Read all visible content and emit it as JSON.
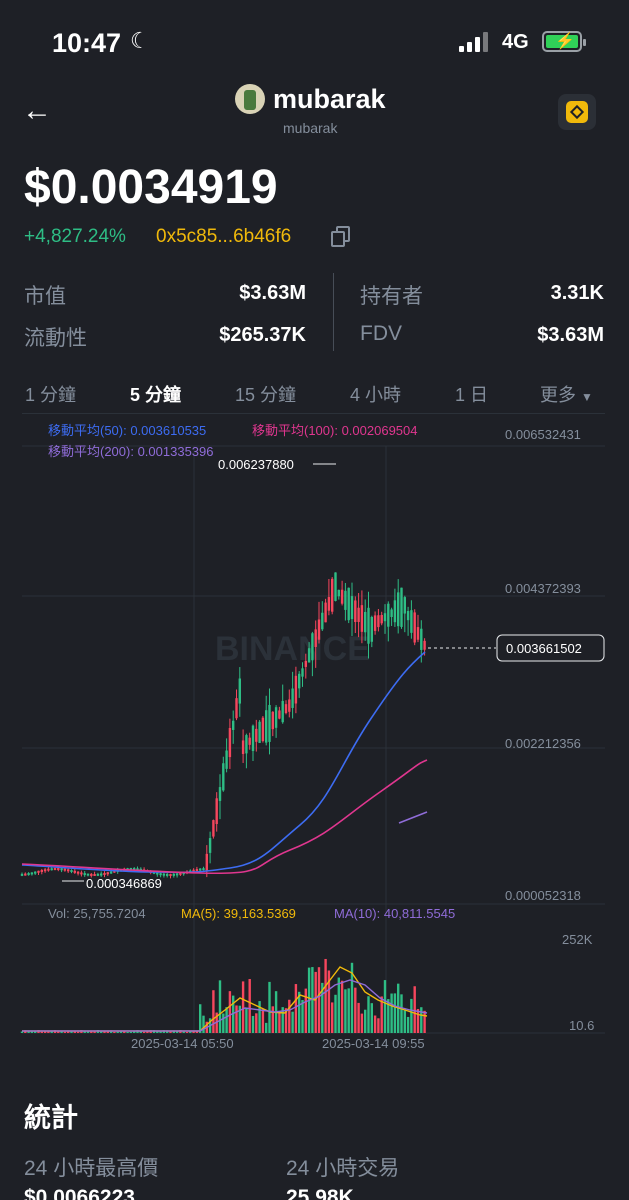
{
  "status_bar": {
    "time": "10:47",
    "network": "4G"
  },
  "header": {
    "title": "mubarak",
    "subtitle": "mubarak"
  },
  "price": "$0.0034919",
  "change": "+4,827.24%",
  "contract": "0x5c85...6b46f6",
  "stats": {
    "market_cap_label": "市值",
    "market_cap_value": "$3.63M",
    "holders_label": "持有者",
    "holders_value": "3.31K",
    "liquidity_label": "流動性",
    "liquidity_value": "$265.37K",
    "fdv_label": "FDV",
    "fdv_value": "$3.63M"
  },
  "tabs": [
    "1 分鐘",
    "5 分鐘",
    "15 分鐘",
    "4 小時",
    "1 日",
    "更多"
  ],
  "active_tab": "5 分鐘",
  "colors": {
    "up": "#2ebd85",
    "down": "#f6465d",
    "ma50": "#3d6cf2",
    "ma100": "#e0368f",
    "ma200": "#8f6cd8",
    "vol_ma5": "#f0b90b",
    "vol_ma10": "#8f6cd8",
    "accent": "#f0b90b"
  },
  "chart": {
    "ma50": "移動平均(50): 0.003610535",
    "ma100": "移動平均(100): 0.002069504",
    "ma200": "移動平均(200): 0.001335396",
    "high_label": "0.006237880",
    "low_label": "0.000346869",
    "last_price_label": "0.003661502",
    "y_ticks": [
      "0.006532431",
      "0.004372393",
      "0.002212356",
      "0.000052318"
    ],
    "vol": "Vol: 25,755.7204",
    "vol_ma5": "MA(5): 39,163.5369",
    "vol_ma10": "MA(10): 40,811.5545",
    "vol_ticks": [
      "252K",
      "10.6"
    ],
    "x_ticks": [
      "2025-03-14 05:50",
      "2025-03-14 09:55"
    ],
    "watermark": "BINANCE"
  },
  "chart_data": {
    "type": "candlestick",
    "ylim": [
      5.2318e-05,
      0.006532431
    ],
    "y_ticks": [
      0.006532431,
      0.004372393,
      0.002212356,
      5.2318e-05
    ],
    "high": 0.00623788,
    "low": 0.000346869,
    "last": 0.003661502,
    "x_ticks": [
      "2025-03-14 05:50",
      "2025-03-14 09:55"
    ],
    "moving_averages": [
      {
        "name": "移動平均(50)",
        "value": 0.003610535
      },
      {
        "name": "移動平均(100)",
        "value": 0.002069504
      },
      {
        "name": "移動平均(200)",
        "value": 0.001335396
      }
    ],
    "volume": {
      "last": 25755.7204,
      "ma5": 39163.5369,
      "ma10": 40811.5545,
      "ticks": [
        "252K",
        "10.6"
      ]
    }
  },
  "section": {
    "title": "統計",
    "high24_label": "24 小時最高價",
    "high24_value": "$0.0066223",
    "trades24_label": "24 小時交易",
    "trades24_value": "25.98K"
  }
}
